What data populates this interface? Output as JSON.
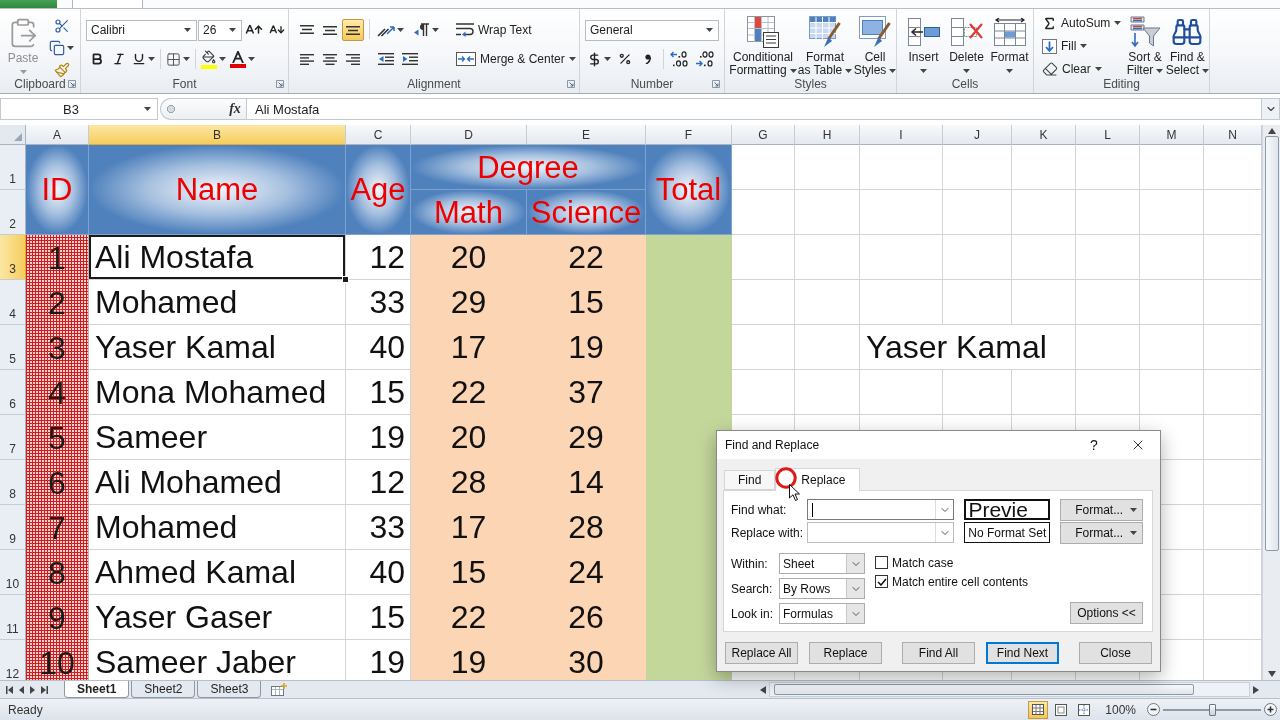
{
  "ribbon_tabs": [
    {
      "kind": "file",
      "selected": false
    },
    {
      "kind": "tab",
      "selected": true
    }
  ],
  "clipboard": {
    "title": "Clipboard",
    "paste": {
      "label": "Paste",
      "disabled": true
    }
  },
  "font": {
    "title": "Font",
    "name": "Calibri",
    "size": "26"
  },
  "alignment": {
    "title": "Alignment",
    "vertical_align": [
      {
        "kind": "top",
        "selected": false
      },
      {
        "kind": "middle",
        "selected": false
      },
      {
        "kind": "bottom",
        "selected": true
      }
    ],
    "wrap_text": "Wrap Text",
    "merge": "Merge & Center"
  },
  "number": {
    "title": "Number",
    "format": "General"
  },
  "styles": {
    "title": "Styles",
    "buttons": [
      {
        "kind": "conditional_formatting",
        "lines": [
          "Conditional",
          "Formatting"
        ]
      },
      {
        "kind": "format_as_table",
        "lines": [
          "Format",
          "as Table"
        ]
      },
      {
        "kind": "cell_styles",
        "lines": [
          "Cell",
          "Styles"
        ]
      }
    ]
  },
  "cells": {
    "title": "Cells",
    "buttons": [
      {
        "kind": "insert",
        "label": "Insert"
      },
      {
        "kind": "delete",
        "label": "Delete"
      },
      {
        "kind": "format",
        "label": "Format"
      }
    ]
  },
  "editing": {
    "title": "Editing",
    "small_buttons": [
      {
        "kind": "autosum",
        "label": "AutoSum"
      },
      {
        "kind": "fill",
        "label": "Fill"
      },
      {
        "kind": "clear",
        "label": "Clear"
      }
    ],
    "buttons": [
      {
        "kind": "sort_filter",
        "lines": [
          "Sort &",
          "Filter"
        ]
      },
      {
        "kind": "find_select",
        "lines": [
          "Find &",
          "Select"
        ]
      }
    ]
  },
  "formula_bar": {
    "name_box": "B3",
    "function_button": "fx",
    "content": "Ali Mostafa"
  },
  "sheet": {
    "columns": [
      {
        "label": "A",
        "selected": false
      },
      {
        "label": "B",
        "selected": true
      },
      {
        "label": "C",
        "selected": false
      },
      {
        "label": "D",
        "selected": false
      },
      {
        "label": "E",
        "selected": false
      },
      {
        "label": "F",
        "selected": false
      },
      {
        "label": "G",
        "selected": false
      },
      {
        "label": "H",
        "selected": false
      },
      {
        "label": "I",
        "selected": false
      },
      {
        "label": "J",
        "selected": false
      },
      {
        "label": "K",
        "selected": false
      },
      {
        "label": "L",
        "selected": false
      },
      {
        "label": "M",
        "selected": false
      },
      {
        "label": "N",
        "selected": false
      }
    ],
    "rows": [
      {
        "label": "1",
        "selected": false
      },
      {
        "label": "2",
        "selected": false
      },
      {
        "label": "3",
        "selected": true
      },
      {
        "label": "4",
        "selected": false
      },
      {
        "label": "5",
        "selected": false
      },
      {
        "label": "6",
        "selected": false
      },
      {
        "label": "7",
        "selected": false
      },
      {
        "label": "8",
        "selected": false
      },
      {
        "label": "9",
        "selected": false
      },
      {
        "label": "10",
        "selected": false
      },
      {
        "label": "11",
        "selected": false
      },
      {
        "label": "12",
        "selected": false
      }
    ],
    "header": {
      "id": "ID",
      "name": "Name",
      "age": "Age",
      "degree": "Degree",
      "math": "Math",
      "science": "Science",
      "total": "Total"
    },
    "records": [
      {
        "id": "1",
        "name": "Ali Mostafa",
        "age": "12",
        "math": "20",
        "science": "22",
        "name_selected": true
      },
      {
        "id": "2",
        "name": "Mohamed",
        "age": "33",
        "math": "29",
        "science": "15",
        "name_selected": false
      },
      {
        "id": "3",
        "name": "Yaser Kamal",
        "age": "40",
        "math": "17",
        "science": "19",
        "name_selected": false
      },
      {
        "id": "4",
        "name": "Mona Mohamed",
        "age": "15",
        "math": "22",
        "science": "37",
        "name_selected": false
      },
      {
        "id": "5",
        "name": "Sameer",
        "age": "19",
        "math": "20",
        "science": "29",
        "name_selected": false
      },
      {
        "id": "6",
        "name": "Ali Mohamed",
        "age": "12",
        "math": "28",
        "science": "14",
        "name_selected": false
      },
      {
        "id": "7",
        "name": "Mohamed",
        "age": "33",
        "math": "17",
        "science": "28",
        "name_selected": false
      },
      {
        "id": "8",
        "name": "Ahmed Kamal",
        "age": "40",
        "math": "15",
        "science": "24",
        "name_selected": false
      },
      {
        "id": "9",
        "name": "Yaser Gaser",
        "age": "15",
        "math": "22",
        "science": "26",
        "name_selected": false
      },
      {
        "id": "10",
        "name": "Sameer Jaber",
        "age": "19",
        "math": "19",
        "science": "30",
        "name_selected": false
      }
    ],
    "cell_i5": "Yaser Kamal"
  },
  "sheet_tabs": [
    {
      "label": "Sheet1",
      "selected": true
    },
    {
      "label": "Sheet2",
      "selected": false
    },
    {
      "label": "Sheet3",
      "selected": false
    }
  ],
  "status_bar": {
    "status": "Ready",
    "views": [
      {
        "kind": "normal",
        "selected": true
      },
      {
        "kind": "page_layout",
        "selected": false
      },
      {
        "kind": "page_break",
        "selected": false
      }
    ],
    "zoom": "100%",
    "zoom_slider": {
      "level": 0.5
    }
  },
  "dialog": {
    "title": "Find and Replace",
    "help": "?",
    "tabs": [
      {
        "label": "Find",
        "selected": false
      },
      {
        "label": "Replace",
        "selected": true
      }
    ],
    "fields": [
      {
        "label": "Find what:",
        "focused": true,
        "preview": {
          "kind": "sample",
          "text": "Previe"
        },
        "format_button": "Format..."
      },
      {
        "label": "Replace with:",
        "focused": false,
        "preview": {
          "kind": "none",
          "text": "No Format Set"
        },
        "format_button": "Format..."
      }
    ],
    "selects": [
      {
        "label": "Within:",
        "value": "Sheet"
      },
      {
        "label": "Search:",
        "value": "By Rows"
      },
      {
        "label": "Look in:",
        "value": "Formulas"
      }
    ],
    "checks": [
      {
        "label": "Match case",
        "checked": false
      },
      {
        "label": "Match entire cell contents",
        "checked": true
      }
    ],
    "options_button": "Options <<",
    "buttons": [
      {
        "label": "Replace All",
        "default": false
      },
      {
        "label": "Replace",
        "default": false
      },
      {
        "label": "Find All",
        "default": false
      },
      {
        "label": "Find Next",
        "default": true
      },
      {
        "label": "Close",
        "default": false
      }
    ]
  }
}
